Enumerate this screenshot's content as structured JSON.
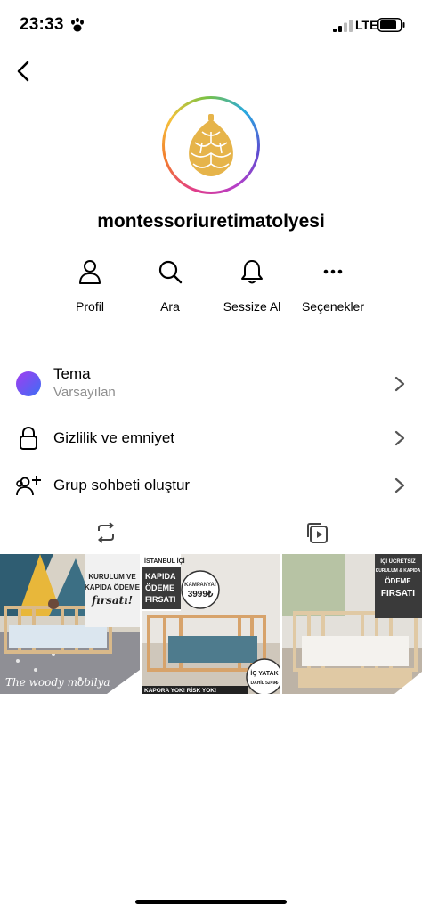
{
  "status_bar": {
    "time": "23:33",
    "network": "LTE"
  },
  "profile": {
    "username": "montessoriuretimatolyesi"
  },
  "actions": [
    {
      "label": "Profil",
      "icon": "user-icon"
    },
    {
      "label": "Ara",
      "icon": "search-icon"
    },
    {
      "label": "Sessize Al",
      "icon": "bell-icon"
    },
    {
      "label": "Seçenekler",
      "icon": "more-icon"
    }
  ],
  "menu": {
    "theme": {
      "title": "Tema",
      "subtitle": "Varsayılan"
    },
    "privacy": {
      "title": "Gizlilik ve emniyet"
    },
    "group_chat": {
      "title": "Grup sohbeti oluştur"
    }
  },
  "tabs": [
    {
      "icon": "repost-icon"
    },
    {
      "icon": "media-icon"
    }
  ],
  "posts": [
    {
      "lines": [
        "KURULUM VE",
        "KAPIDA ÖDEME",
        "fırsatı!"
      ],
      "watermark": "The woody mobilya"
    },
    {
      "top": "İSTANBUL İÇİ",
      "lines": [
        "KAPIDA",
        "ÖDEME",
        "FIRSATI"
      ],
      "badge": "KAMPANYA!",
      "price": "3999₺",
      "extra": "İÇ YATAK",
      "extra_sub": "DAHİL 5249₺",
      "bottom": "KAPORA YOK! RİSK YOK!"
    },
    {
      "lines": [
        "İÇİ ÜCRETSİZ",
        "KURULUM & KAPIDA",
        "ÖDEME",
        "FIRSATI"
      ]
    }
  ],
  "colors": {
    "accent_gold": "#e6b44a",
    "theme_purple": "#a23cf0",
    "theme_blue": "#3b6ff5"
  }
}
